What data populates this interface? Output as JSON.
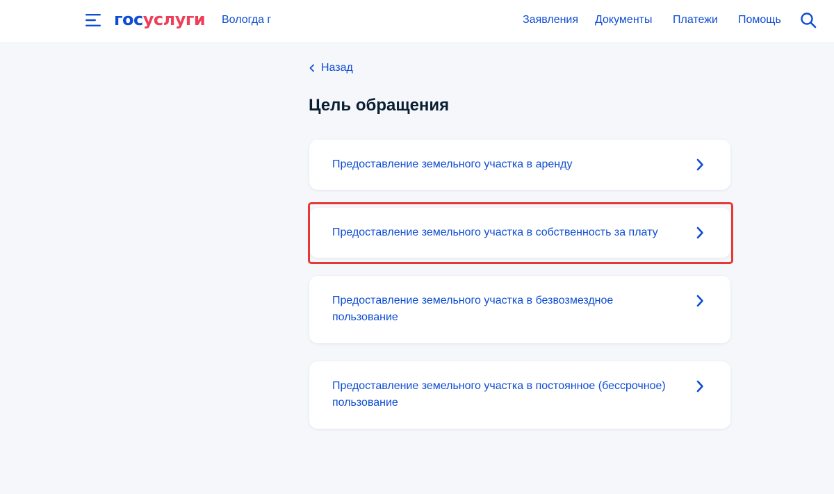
{
  "header": {
    "logo": {
      "part1": "гос",
      "part2": "услуги"
    },
    "region": "Вологда г",
    "nav": [
      "Заявления",
      "Документы",
      "Платежи",
      "Помощь"
    ]
  },
  "back_label": "Назад",
  "page_title": "Цель обращения",
  "options": [
    "Предоставление земельного участка в аренду",
    "Предоставление земельного участка в собственность за плату",
    "Предоставление земельного участка в безвозмездное пользование",
    "Предоставление земельного участка в постоянное (бессрочное) пользование"
  ],
  "icons": {
    "menu": "menu-icon",
    "search": "search-icon",
    "back": "chevron-left-icon",
    "option": "chevron-right-icon"
  },
  "colors": {
    "link": "#0d4cd3",
    "brand_red": "#ee3f58",
    "highlight": "#e53935",
    "text_dark": "#0b1f33",
    "page_bg": "#f5f7fb"
  }
}
